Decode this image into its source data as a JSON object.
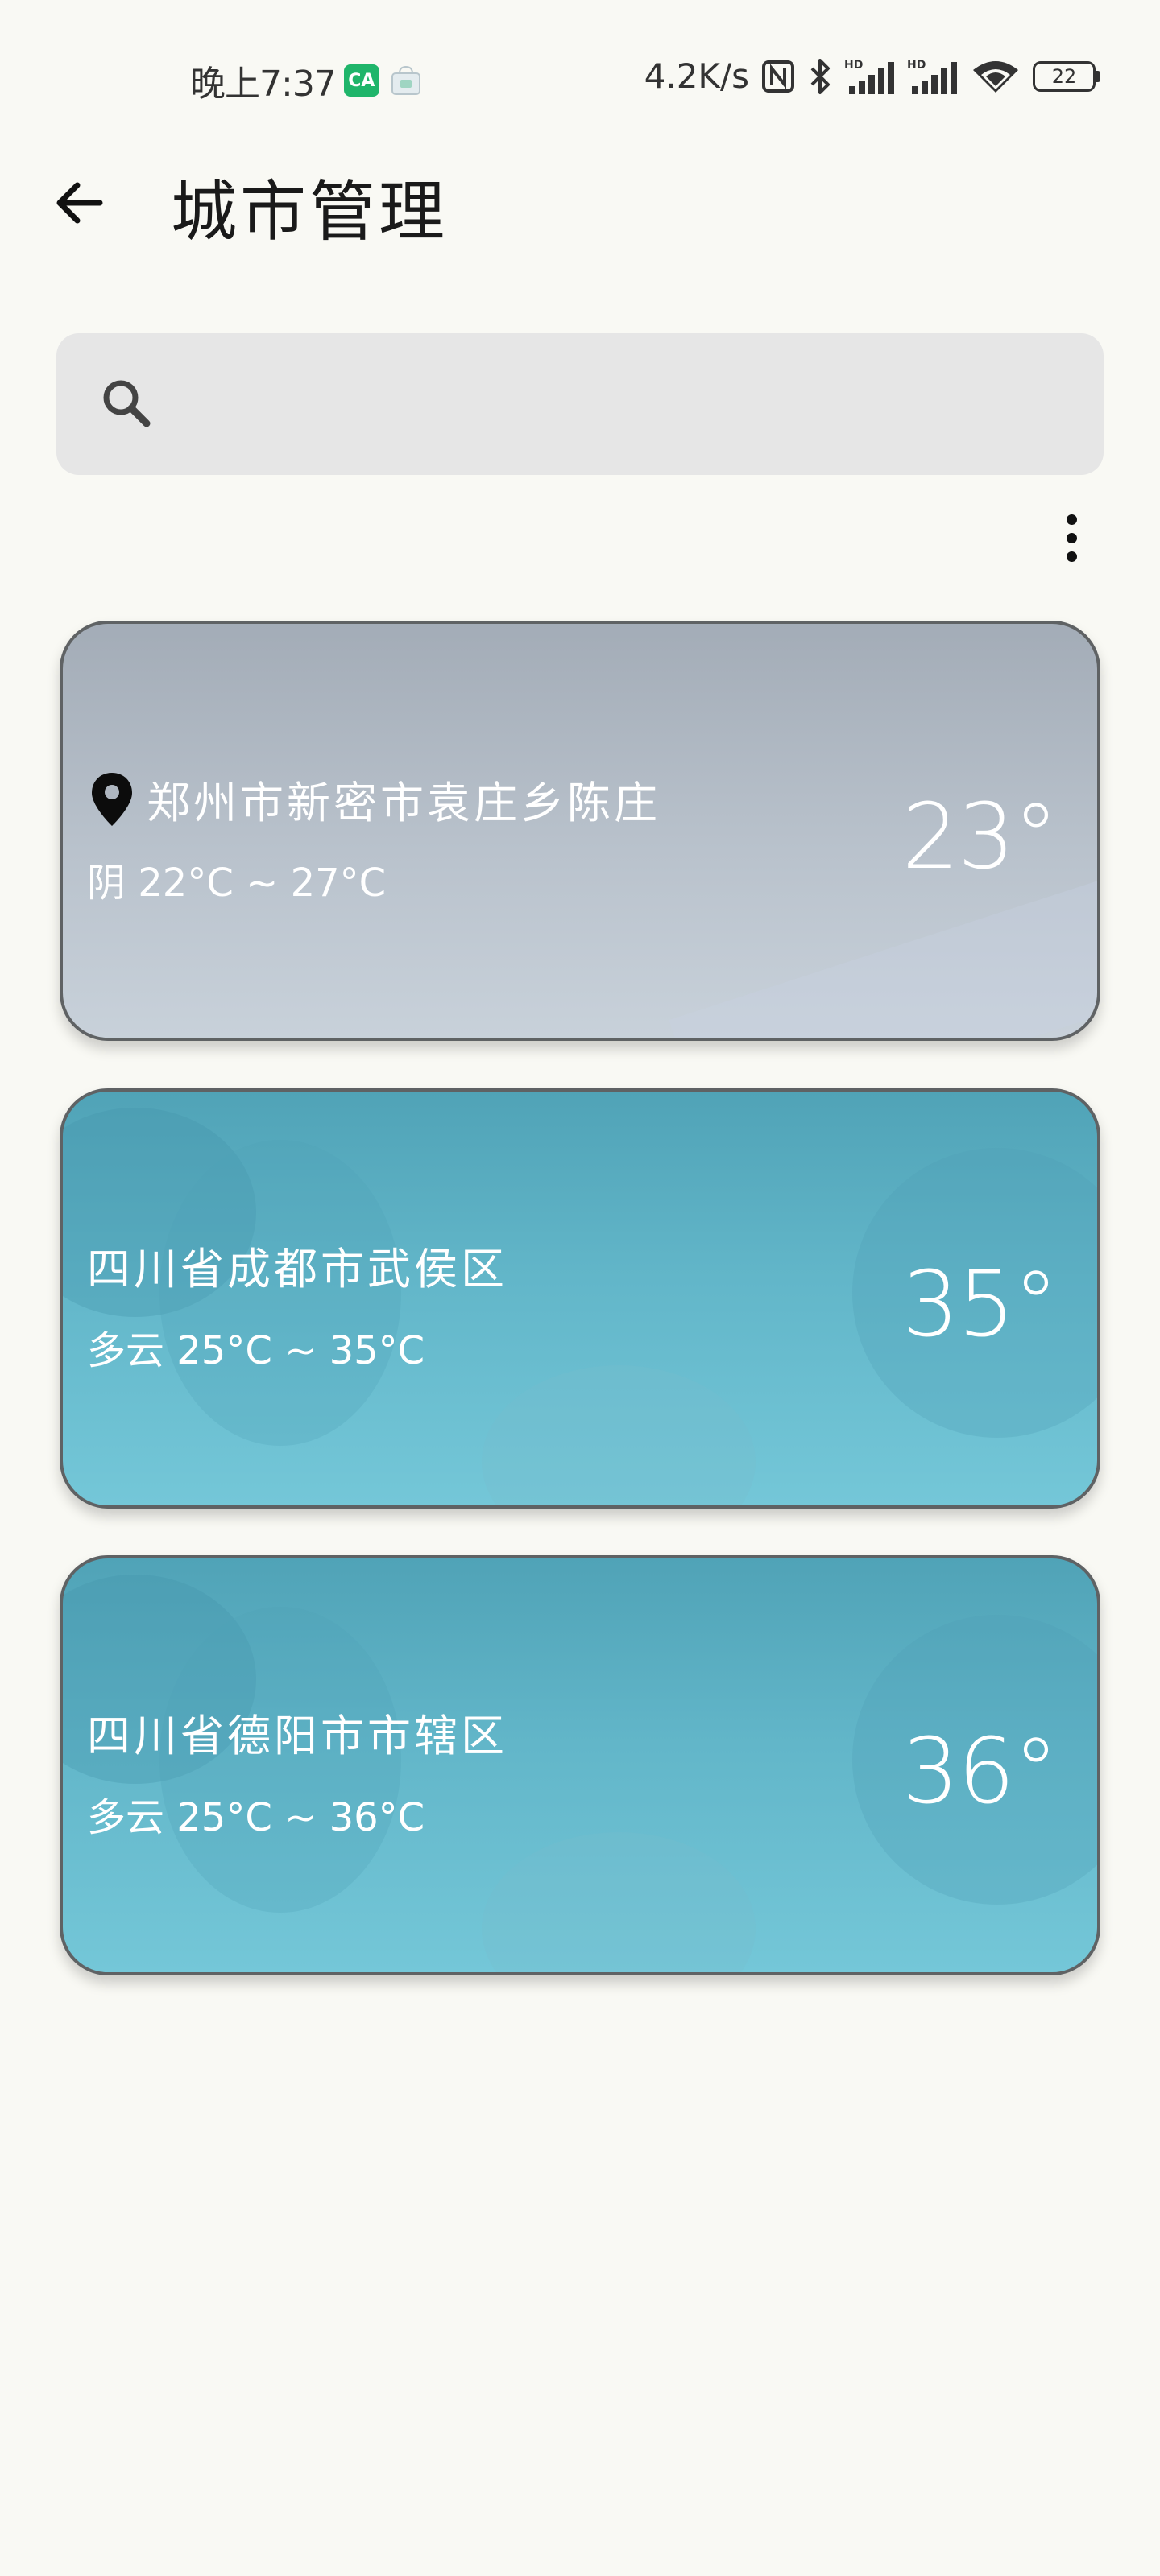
{
  "status_bar": {
    "time": "晚上7:37",
    "app_badge": "CA",
    "net_speed": "4.2K/s",
    "battery": "22"
  },
  "header": {
    "title": "城市管理"
  },
  "search": {
    "placeholder": "",
    "value": ""
  },
  "cities": [
    {
      "name": "郑州市新密市袁庄乡陈庄",
      "is_current_location": true,
      "condition_range": "阴 22°C ~ 27°C",
      "current_temp": "23°",
      "theme": "cloudy"
    },
    {
      "name": "四川省成都市武侯区",
      "is_current_location": false,
      "condition_range": "多云 25°C ~ 35°C",
      "current_temp": "35°",
      "theme": "partly-cloudy"
    },
    {
      "name": "四川省德阳市市辖区",
      "is_current_location": false,
      "condition_range": "多云 25°C ~ 36°C",
      "current_temp": "36°",
      "theme": "partly-cloudy"
    }
  ],
  "icons": {
    "back": "arrow-left-icon",
    "search": "search-icon",
    "more": "more-vertical-icon",
    "location": "location-pin-icon"
  },
  "colors": {
    "background": "#f9f9f4",
    "search_bg": "#e6e6e6",
    "cloudy_card": "#aeb6c0",
    "partly_cloudy_card": "#5fb2c6",
    "app_badge": "#1fb56a"
  }
}
